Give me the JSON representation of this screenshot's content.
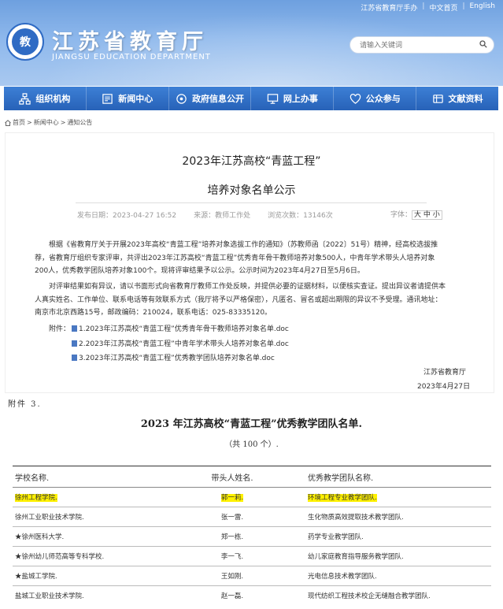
{
  "toplinks": {
    "mobile": "江苏省教育厅手办",
    "cn": "中文首页",
    "sep": "|",
    "en": "English"
  },
  "site": {
    "name": "江苏省教育厅",
    "name_en": "JIANGSU EDUCATION DEPARTMENT",
    "logo_text": "教"
  },
  "search": {
    "placeholder": "请输入关键词"
  },
  "nav": [
    {
      "label": "组织机构",
      "icon": "org-icon"
    },
    {
      "label": "新闻中心",
      "icon": "news-icon"
    },
    {
      "label": "政府信息公开",
      "icon": "info-icon"
    },
    {
      "label": "网上办事",
      "icon": "monitor-icon"
    },
    {
      "label": "公众参与",
      "icon": "heart-icon"
    },
    {
      "label": "文献资料",
      "icon": "docs-icon"
    }
  ],
  "breadcrumb": {
    "home": "首页",
    "sep": ">",
    "news": "新闻中心",
    "notice": "通知公告"
  },
  "article": {
    "title_line1": "2023年江苏高校“青蓝工程”",
    "title_line2": "培养对象名单公示",
    "date": "发布日期：2023-04-27 16:52",
    "source": "来源：教师工作处",
    "views": "浏览次数：13146次",
    "font_label": "字体：",
    "font_sizes": "大 中 小",
    "p1_l1": "根据《省教育厅关于开展2023年高校“青蓝工程”培养对象选拔工作的通知》（苏教师函〔2022〕51号）精神，经高校选拔推",
    "p1_l2": "荐，省教育厅组织专家评审，共评出2023年江苏高校“青蓝工程”优秀青年骨干教师培养对象500人，中青年学术带头人培养对象",
    "p1_l3": "200人，优秀教学团队培养对象100个。现将评审结果予以公示。公示时间为2023年4月27日至5月6日。",
    "p2_l1": "对评审结果如有异议，请以书面形式向省教育厅教师工作处反映，并提供必要的证据材料，以便核实查证。提出异议者请提供本",
    "p2_l2": "人真实姓名、工作单位、联系电话等有效联系方式（我厅将予以严格保密），凡匿名、冒名或超出期限的异议不予受理。通讯地址：",
    "p2_l3": "南京市北京西路15号，邮政编码：210024，联系电话：025-83335120。",
    "attach_label": "附件：",
    "attachments": [
      "1.2023年江苏高校“青蓝工程”优秀青年骨干教师培养对象名单.doc",
      "2.2023年江苏高校“青蓝工程”中青年学术带头人培养对象名单.doc",
      "3.2023年江苏高校“青蓝工程”优秀教学团队培养对象名单.doc"
    ],
    "sign_org": "江苏省教育厅",
    "sign_date": "2023年4月27日"
  },
  "scan": {
    "attach_no": "附件 3.",
    "title": "2023 年江苏高校“青蓝工程”优秀教学团队名单.",
    "subtitle": "（共 100 个）.",
    "headers": [
      "学校名称.",
      "带头人姓名.",
      "优秀教学团队名称."
    ],
    "rows": [
      [
        "徐州工程学院.",
        "郭一莉.",
        "环境工程专业教学团队."
      ],
      [
        "徐州工业职业技术学院.",
        "张一雷.",
        "生化物质高效提取技术教学团队."
      ],
      [
        "★徐州医科大学.",
        "郑一栋.",
        "药学专业教学团队."
      ],
      [
        "★徐州幼儿师范高等专科学校.",
        "李一飞.",
        "幼儿家庭教育指导服务教学团队."
      ],
      [
        "★盐城工学院.",
        "王如刚.",
        "光电信息技术教学团队."
      ],
      [
        "盐城工业职业技术学院.",
        "赵一磊.",
        "现代纺织工程技术校企无缝融合教学团队."
      ]
    ]
  }
}
